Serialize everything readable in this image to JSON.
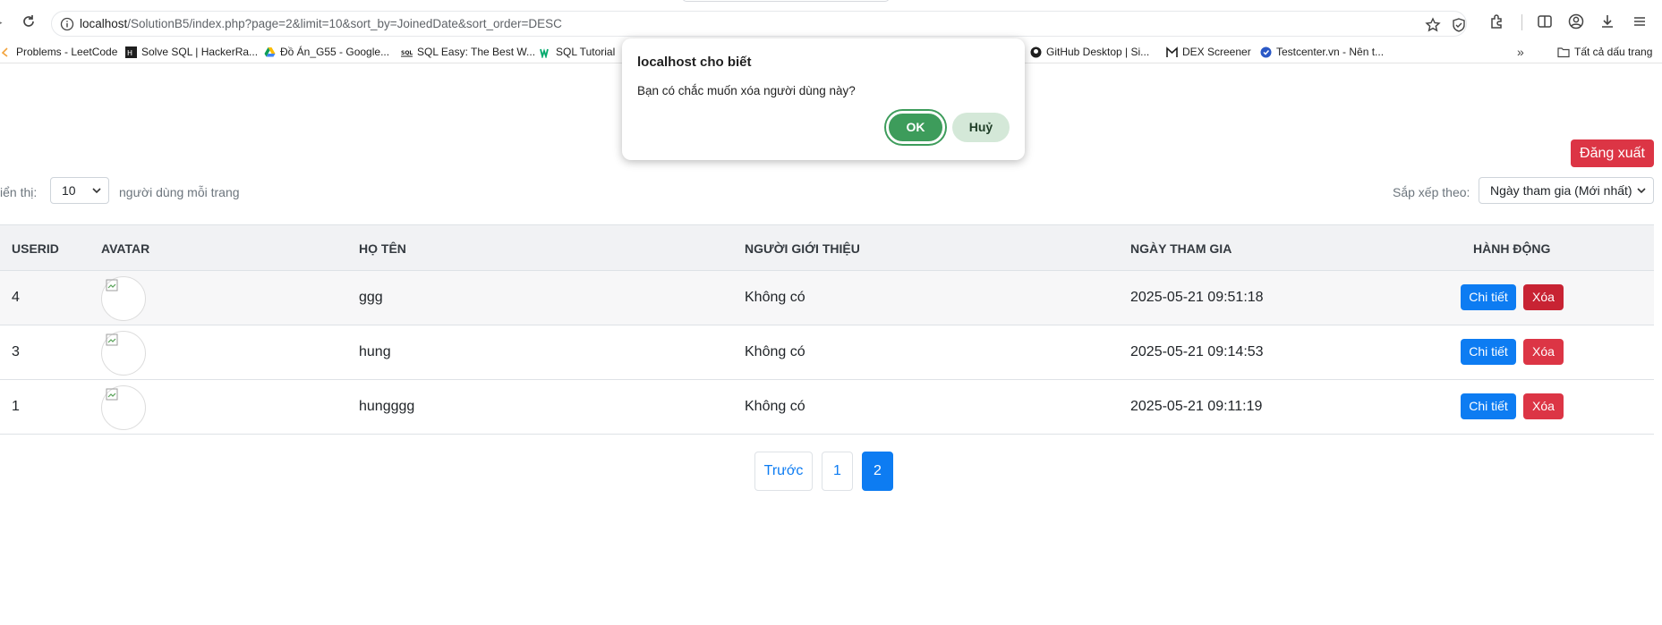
{
  "browser": {
    "url_host": "localhost",
    "url_path": "/SolutionB5/index.php?page=2&limit=10&sort_by=JoinedDate&sort_order=DESC",
    "bookmarks": [
      {
        "label": "Problems - LeetCode",
        "icon": "leetcode-icon"
      },
      {
        "label": "Solve SQL | HackerRa...",
        "icon": "hackerrank-icon"
      },
      {
        "label": "Đồ Án_G55 - Google...",
        "icon": "google-drive-icon"
      },
      {
        "label": "SQL Easy: The Best W...",
        "icon": "sqleasy-icon"
      },
      {
        "label": "SQL Tutorial",
        "icon": "w3schools-icon"
      },
      {
        "label": "GitHub Desktop | Si...",
        "icon": "github-icon"
      },
      {
        "label": "DEX Screener",
        "icon": "dexscreener-icon"
      },
      {
        "label": "Testcenter.vn - Nên t...",
        "icon": "testcenter-icon"
      }
    ],
    "all_bookmarks_label": "Tất cả dấu trang"
  },
  "dialog": {
    "title": "localhost cho biết",
    "message": "Bạn có chắc muốn xóa người dùng này?",
    "ok_label": "OK",
    "cancel_label": "Huỷ"
  },
  "page": {
    "logout_label": "Đăng xuất",
    "show_label": "iển thị:",
    "limit_value": "10",
    "per_page_label": "người dùng mỗi trang",
    "sort_label": "Sắp xếp theo:",
    "sort_value": "Ngày tham gia (Mới nhất)"
  },
  "table": {
    "headers": [
      "USERID",
      "AVATAR",
      "HỌ TÊN",
      "NGƯỜI GIỚI THIỆU",
      "NGÀY THAM GIA",
      "HÀNH ĐỘNG"
    ],
    "rows": [
      {
        "id": "4",
        "name": "ggg",
        "referrer": "Không có",
        "joined": "2025-05-21 09:51:18",
        "detail": "Chi tiết",
        "delete": "Xóa"
      },
      {
        "id": "3",
        "name": "hung",
        "referrer": "Không có",
        "joined": "2025-05-21 09:14:53",
        "detail": "Chi tiết",
        "delete": "Xóa"
      },
      {
        "id": "1",
        "name": "hungggg",
        "referrer": "Không có",
        "joined": "2025-05-21 09:11:19",
        "detail": "Chi tiết",
        "delete": "Xóa"
      }
    ]
  },
  "pagination": {
    "prev_label": "Trước",
    "pages": [
      "1",
      "2"
    ],
    "current": "2"
  },
  "colors": {
    "primary": "#0d7cf2",
    "danger": "#dc3545",
    "danger_active": "#c82333",
    "dialog_ok": "#3d9c5b"
  }
}
